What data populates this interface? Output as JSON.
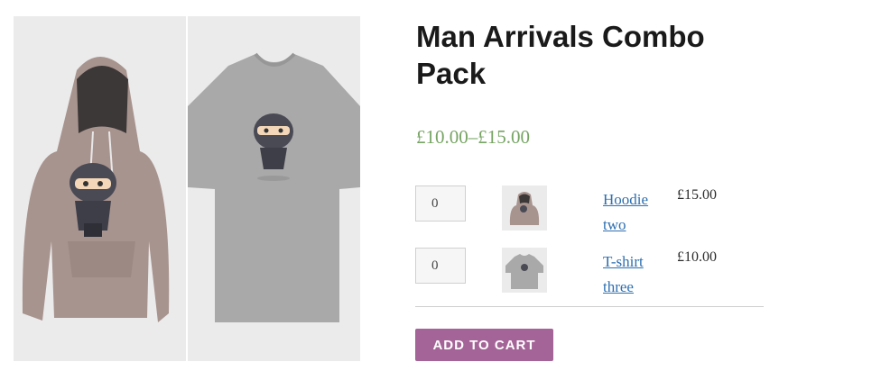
{
  "product": {
    "title": "Man Arrivals Combo Pack",
    "price_range": "£10.00–£15.00",
    "gallery": [
      {
        "icon": "hoodie-ninja-image"
      },
      {
        "icon": "tshirt-ninja-image"
      }
    ]
  },
  "grouped_items": [
    {
      "quantity": "0",
      "label": "Hoodie two",
      "price": "£15.00",
      "thumb_icon": "hoodie-thumbnail"
    },
    {
      "quantity": "0",
      "label": "T-shirt three",
      "price": "£10.00",
      "thumb_icon": "tshirt-thumbnail"
    }
  ],
  "actions": {
    "add_to_cart": "ADD TO CART"
  },
  "colors": {
    "price": "#77a464",
    "link": "#2e6fb0",
    "button": "#a46497",
    "hoodie": "#a8948f",
    "tshirt": "#a9a9a9"
  }
}
